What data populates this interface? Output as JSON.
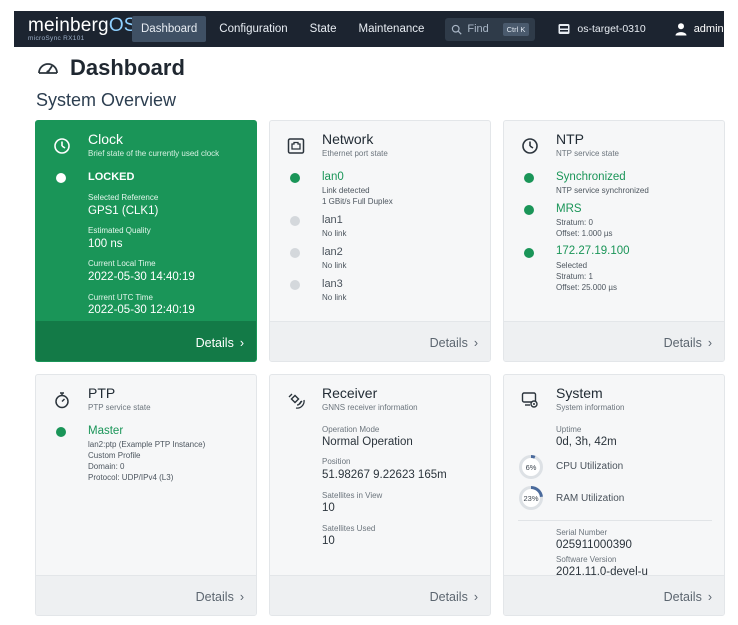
{
  "brand": {
    "name": "meinberg",
    "os": "OS",
    "subtitle": "microSync RX101"
  },
  "nav": {
    "items": [
      "Dashboard",
      "Configuration",
      "State",
      "Maintenance"
    ],
    "active": "Dashboard",
    "find_placeholder": "Find",
    "find_shortcut": "Ctrl K",
    "target": "os-target-0310",
    "user": "admin"
  },
  "page": {
    "title": "Dashboard",
    "section": "System Overview"
  },
  "colors": {
    "green": "#1a9558",
    "nav_bg": "#1c2430",
    "gauge": "#4a6a9c"
  },
  "cards": {
    "clock": {
      "title": "Clock",
      "subtitle": "Brief state of the currently used clock",
      "status": "LOCKED",
      "ref_label": "Selected Reference",
      "ref_value": "GPS1 (CLK1)",
      "quality_label": "Estimated Quality",
      "quality_value": "100 ns",
      "local_label": "Current Local Time",
      "local_value": "2022-05-30 14:40:19",
      "utc_label": "Current UTC Time",
      "utc_value": "2022-05-30 12:40:19",
      "details": "Details"
    },
    "network": {
      "title": "Network",
      "subtitle": "Ethernet port state",
      "ports": [
        {
          "name": "lan0",
          "line1": "Link detected",
          "line2": "1 GBit/s Full Duplex"
        },
        {
          "name": "lan1",
          "line1": "No link"
        },
        {
          "name": "lan2",
          "line1": "No link"
        },
        {
          "name": "lan3",
          "line1": "No link"
        }
      ],
      "details": "Details"
    },
    "ntp": {
      "title": "NTP",
      "subtitle": "NTP service state",
      "sync_title": "Synchronized",
      "sync_desc": "NTP service synchronized",
      "mrs_title": "MRS",
      "mrs_stratum": "Stratum: 0",
      "mrs_offset": "Offset: 1.000 µs",
      "peer_title": "172.27.19.100",
      "peer_state": "Selected",
      "peer_stratum": "Stratum: 1",
      "peer_offset": "Offset: 25.000 µs",
      "details": "Details"
    },
    "ptp": {
      "title": "PTP",
      "subtitle": "PTP service state",
      "role": "Master",
      "instance": "lan2:ptp (Example PTP Instance)",
      "profile": "Custom Profile",
      "domain": "Domain: 0",
      "protocol": "Protocol: UDP/IPv4 (L3)",
      "details": "Details"
    },
    "receiver": {
      "title": "Receiver",
      "subtitle": "GNNS receiver information",
      "mode_label": "Operation Mode",
      "mode_value": "Normal Operation",
      "pos_label": "Position",
      "pos_value": "51.98267 9.22623 165m",
      "siv_label": "Satellites in View",
      "siv_value": "10",
      "used_label": "Satellites Used",
      "used_value": "10",
      "details": "Details"
    },
    "system": {
      "title": "System",
      "subtitle": "System information",
      "uptime_label": "Uptime",
      "uptime_value": "0d, 3h, 42m",
      "cpu_label": "CPU Utilization",
      "cpu_text": "6%",
      "cpu_value": 6,
      "ram_label": "RAM Utilization",
      "ram_text": "23%",
      "ram_value": 23,
      "serial_label": "Serial Number",
      "serial_value": "025911000390",
      "sw_label": "Software Version",
      "sw_value": "2021.11.0-devel-u",
      "details": "Details"
    }
  }
}
